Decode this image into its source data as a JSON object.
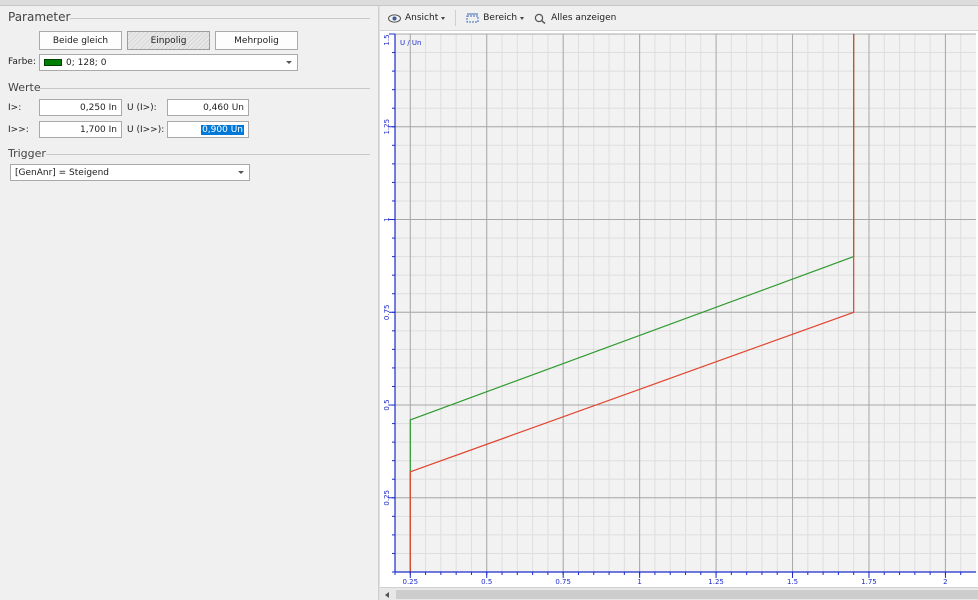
{
  "parameter": {
    "title": "Parameter",
    "buttons": [
      "Beide gleich",
      "Einpolig",
      "Mehrpolig"
    ],
    "active_button": 1,
    "farbe_label": "Farbe:",
    "farbe_value": "0; 128; 0",
    "farbe_color": "#008000"
  },
  "werte": {
    "title": "Werte",
    "rows": [
      {
        "label": "I>:",
        "value": "0,250 In",
        "ulabel": "U (I>):",
        "uvalue": "0,460 Un"
      },
      {
        "label": "I>>:",
        "value": "1,700 In",
        "ulabel": "U (I>>):",
        "uvalue": "0,900 Un"
      }
    ]
  },
  "trigger": {
    "title": "Trigger",
    "value": "[GenAnr] = Steigend"
  },
  "toolbar": {
    "ansicht": "Ansicht",
    "bereich": "Bereich",
    "alles": "Alles anzeigen"
  },
  "chart_data": {
    "type": "line",
    "ylabel": "U / Un",
    "xlim": [
      0.2,
      2.1
    ],
    "ylim": [
      0.05,
      1.5
    ],
    "x_ticks": [
      {
        "v": 0.25,
        "t": "0.25"
      },
      {
        "v": 0.5,
        "t": "0.5"
      },
      {
        "v": 0.75,
        "t": "0.75"
      },
      {
        "v": 1,
        "t": "1"
      },
      {
        "v": 1.25,
        "t": "1.25"
      },
      {
        "v": 1.5,
        "t": "1.5"
      },
      {
        "v": 1.75,
        "t": "1.75"
      },
      {
        "v": 2,
        "t": "2"
      }
    ],
    "y_ticks": [
      {
        "v": 0.25,
        "t": "0.25"
      },
      {
        "v": 0.5,
        "t": "0.5"
      },
      {
        "v": 0.75,
        "t": "0.75"
      },
      {
        "v": 1,
        "t": "1"
      },
      {
        "v": 1.25,
        "t": "1.25"
      },
      {
        "v": 1.5,
        "t": "1.5"
      }
    ],
    "grid": true,
    "series": [
      {
        "color": "#2e9a2e",
        "points": [
          [
            0.25,
            0.0
          ],
          [
            0.25,
            0.46
          ],
          [
            1.7,
            0.9
          ],
          [
            1.7,
            1.5
          ]
        ]
      },
      {
        "color": "#e0442e",
        "points": [
          [
            0.25,
            0.0
          ],
          [
            0.25,
            0.32
          ],
          [
            1.7,
            0.75
          ],
          [
            1.7,
            1.5
          ]
        ]
      }
    ]
  }
}
